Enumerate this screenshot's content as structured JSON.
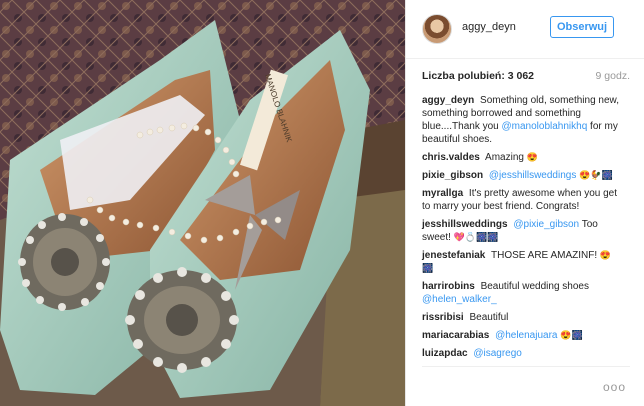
{
  "header": {
    "username": "aggy_deyn",
    "follow_label": "Obserwuj"
  },
  "meta": {
    "likes": "Liczba polubień: 3 062",
    "time": "9 godz."
  },
  "caption": {
    "user": "aggy_deyn",
    "text": "Something old, something new, something borrowed and something blue....Thank you",
    "mention": "@manoloblahnikhq",
    "text2": "for my beautiful shoes."
  },
  "comments": [
    {
      "user": "chris.valdes",
      "text": "Amazing",
      "emoji": "😍"
    },
    {
      "user": "pixie_gibson",
      "mention": "@jesshillsweddings",
      "emoji": "😍🐓🎆"
    },
    {
      "user": "myrallga",
      "text": "It's pretty awesome when you get to marry your best friend. Congrats!"
    },
    {
      "user": "jesshillsweddings",
      "mention": "@pixie_gibson",
      "text": "Too sweet!",
      "emoji": "💖💍🎆🎆"
    },
    {
      "user": "jenestefaniak",
      "text": "THOSE ARE AMAZINF!",
      "emoji": "😍🎆"
    },
    {
      "user": "harrirobins",
      "text": "Beautiful wedding shoes",
      "mention": "@helen_walker_"
    },
    {
      "user": "rissribisi",
      "text": "Beautiful"
    },
    {
      "user": "mariacarabias",
      "mention": "@helenajuara",
      "emoji": "😍🎆"
    },
    {
      "user": "luizapdac",
      "mention": "@isagrego"
    }
  ],
  "photo": {
    "label_text": "MANOLO BLAHNIK",
    "colors": {
      "shoe": "#a9cfc0",
      "insole": "#b2774a",
      "carpet": "#5a3f45",
      "ribbon": "#a49d99"
    }
  },
  "more_icon": "ellipsis-icon",
  "more_text": "ooo"
}
